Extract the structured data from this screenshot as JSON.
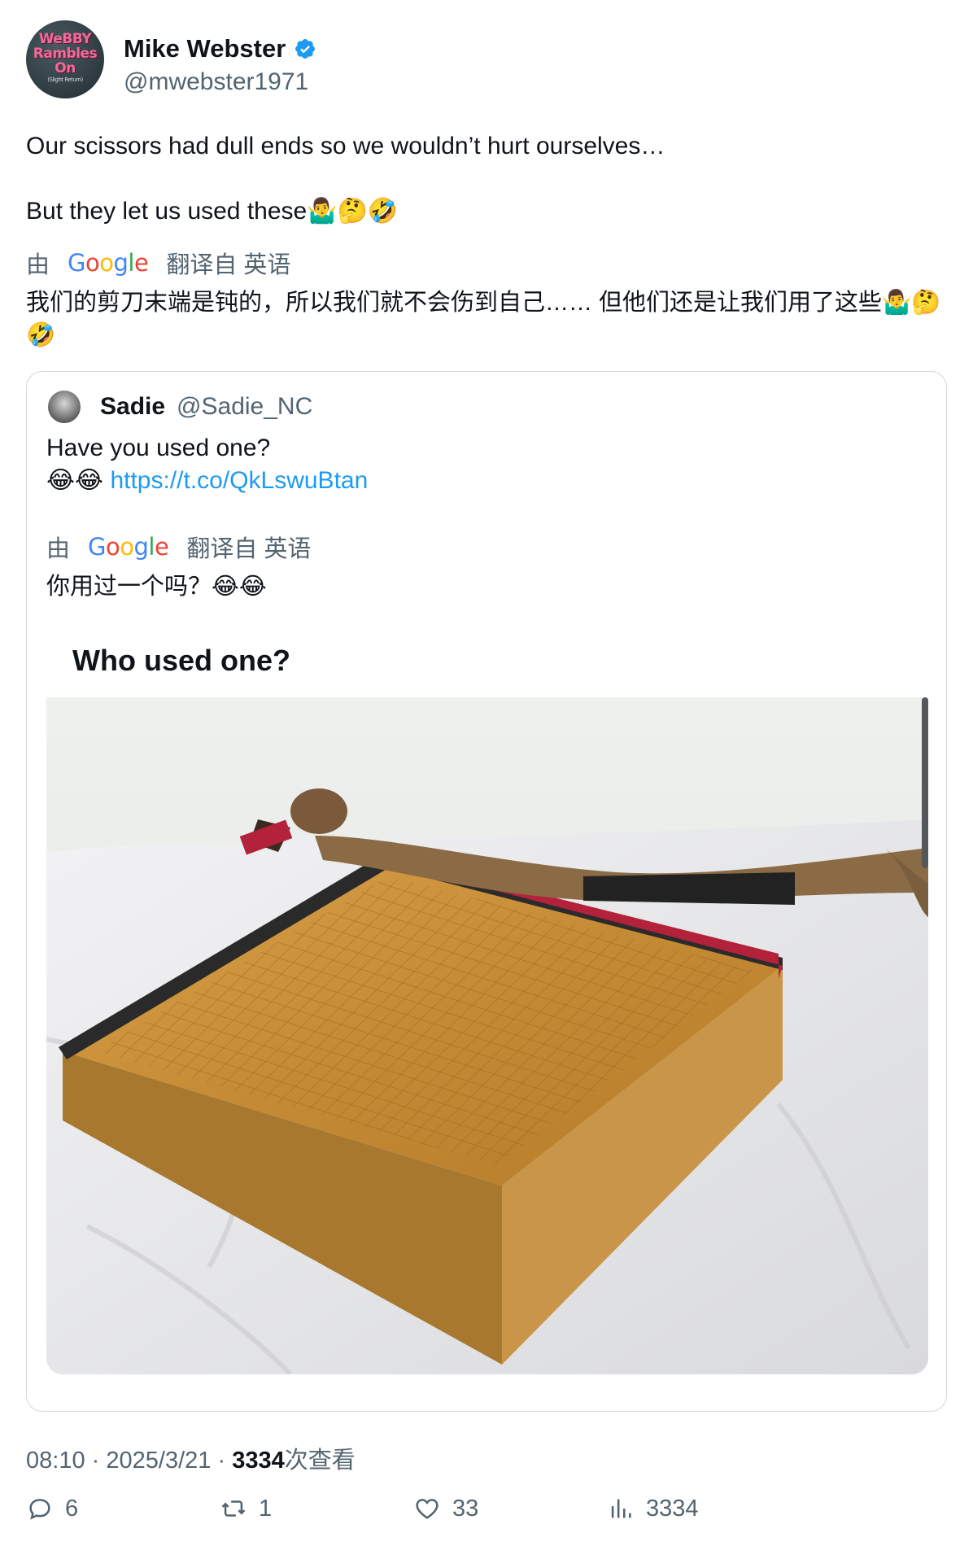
{
  "author": {
    "display_name": "Mike Webster",
    "handle": "@mwebster1971",
    "avatar_text": [
      "WeBBY",
      "Rambles",
      "On"
    ],
    "avatar_subtext": "(Slight Return)",
    "verified": true
  },
  "tweet": {
    "line1": "Our scissors had dull ends so we wouldn’t hurt ourselves…",
    "line2": "But they let us used these🤷‍♂️🤔🤣",
    "translation_prefix": "由",
    "translation_brand": "Google",
    "translation_suffix": "翻译自 英语",
    "translated_text": "我们的剪刀末端是钝的，所以我们就不会伤到自己…… 但他们还是让我们用了这些🤷‍♂️🤔🤣"
  },
  "quoted_tweet": {
    "display_name": "Sadie",
    "handle": "@Sadie_NC",
    "text_line1": "Have you used one?",
    "text_emoji": "😂😂",
    "link": "https://t.co/QkLswuBtan",
    "translation_prefix": "由",
    "translation_brand": "Google",
    "translation_suffix": "翻译自 英语",
    "translated_text": "你用过一个吗？😂😂",
    "media_caption": "Who used one?"
  },
  "meta": {
    "time": "08:10",
    "date": "2025/3/21",
    "views_count": "3334",
    "views_label": "次查看",
    "separator": "·"
  },
  "actions": {
    "replies": "6",
    "retweets": "1",
    "likes": "33",
    "views": "3334"
  },
  "colors": {
    "link": "#1d9bf0",
    "secondary_text": "#536471",
    "verified": "#1d9bf0",
    "google_blue": "#4285f4",
    "google_red": "#ea4335",
    "google_yellow": "#fbbc05",
    "google_green": "#34a853"
  }
}
